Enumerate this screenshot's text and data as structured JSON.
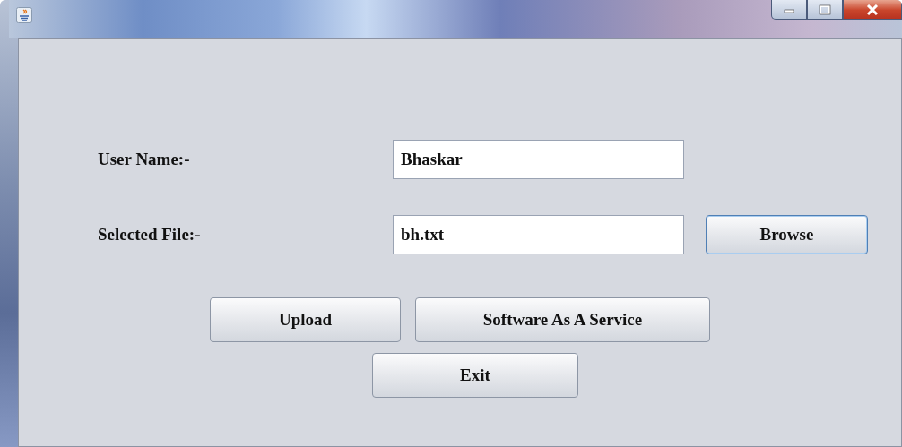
{
  "form": {
    "fields": [
      {
        "label": "User Name:-",
        "value": "Bhaskar"
      },
      {
        "label": "Selected File:-",
        "value": "bh.txt"
      }
    ],
    "browse_button": "Browse"
  },
  "actions": [
    {
      "label": "Upload"
    },
    {
      "label": "Software As A Service"
    }
  ],
  "exit_button": "Exit"
}
